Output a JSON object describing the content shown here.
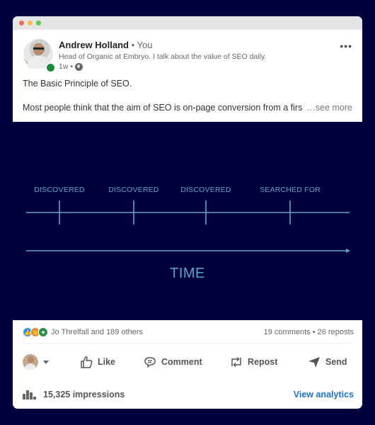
{
  "window": {
    "controls": [
      "close",
      "minimize",
      "maximize"
    ]
  },
  "post": {
    "author_name": "Andrew Holland",
    "author_relation": "• You",
    "headline": "Head of Organic at Embryo. I talk about the value of SEO daily.",
    "time_ago": "1w •",
    "visibility_icon": "globe-icon",
    "more_icon": "•••",
    "text_line1": "The Basic Principle of SEO.",
    "text_line2": "Most people think that the aim of SEO is on-page conversion from a first-time",
    "see_more": "…see more"
  },
  "diagram": {
    "stage_labels": [
      "DISCOVERED",
      "DISCOVERED",
      "DISCOVERED",
      "SEARCHED FOR"
    ],
    "axis_label": "TIME",
    "line_color": "#5ba6c4",
    "background": "#03013d"
  },
  "social": {
    "reactions": [
      "like",
      "celebrate",
      "support"
    ],
    "reactors_text": "Jo Threlfall and 189 others",
    "counts_text": "19 comments • 26 reposts"
  },
  "actions": [
    {
      "id": "like",
      "label": "Like"
    },
    {
      "id": "comment",
      "label": "Comment"
    },
    {
      "id": "repost",
      "label": "Repost"
    },
    {
      "id": "send",
      "label": "Send"
    }
  ],
  "analytics": {
    "impressions": "15,325 impressions",
    "view_analytics": "View analytics",
    "link_color": "#1a73c9"
  }
}
